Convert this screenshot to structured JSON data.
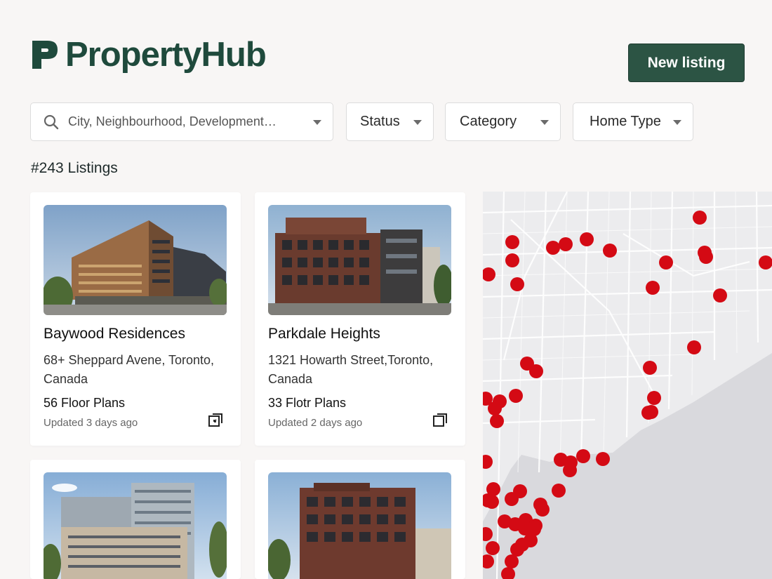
{
  "brand": {
    "name": "PropertyHub",
    "color": "#1f4a3c"
  },
  "header": {
    "new_listing_label": "New listing"
  },
  "filters": {
    "search_placeholder": "City, Neighbourhood, Development…",
    "status_label": "Status",
    "category_label": "Category",
    "home_type_label": "Home Type"
  },
  "listings_count_label": "#243 Listings",
  "listings": [
    {
      "name": "Baywood Residences",
      "address": "68+ Sheppard Avene, Toronto, Canada",
      "floor_plans": "56 Floor Plans",
      "updated": "Updated 3 days ago"
    },
    {
      "name": "Parkdale Heights",
      "address": "1321 Howarth Street,Toronto, Canada",
      "floor_plans": "33 Flotr Plans",
      "updated": "Updated 2 days ago"
    },
    {
      "name": "",
      "address": "",
      "floor_plans": "",
      "updated": ""
    },
    {
      "name": "",
      "address": "",
      "floor_plans": "",
      "updated": ""
    }
  ],
  "map": {
    "marker_color": "#d40a14",
    "water_color": "#d9d9dd",
    "land_color": "#ececee",
    "marker_count": 55
  },
  "icons": [
    "logo-p-icon",
    "search-icon",
    "chevron-down-icon",
    "open-external-icon",
    "map-marker-icon"
  ]
}
